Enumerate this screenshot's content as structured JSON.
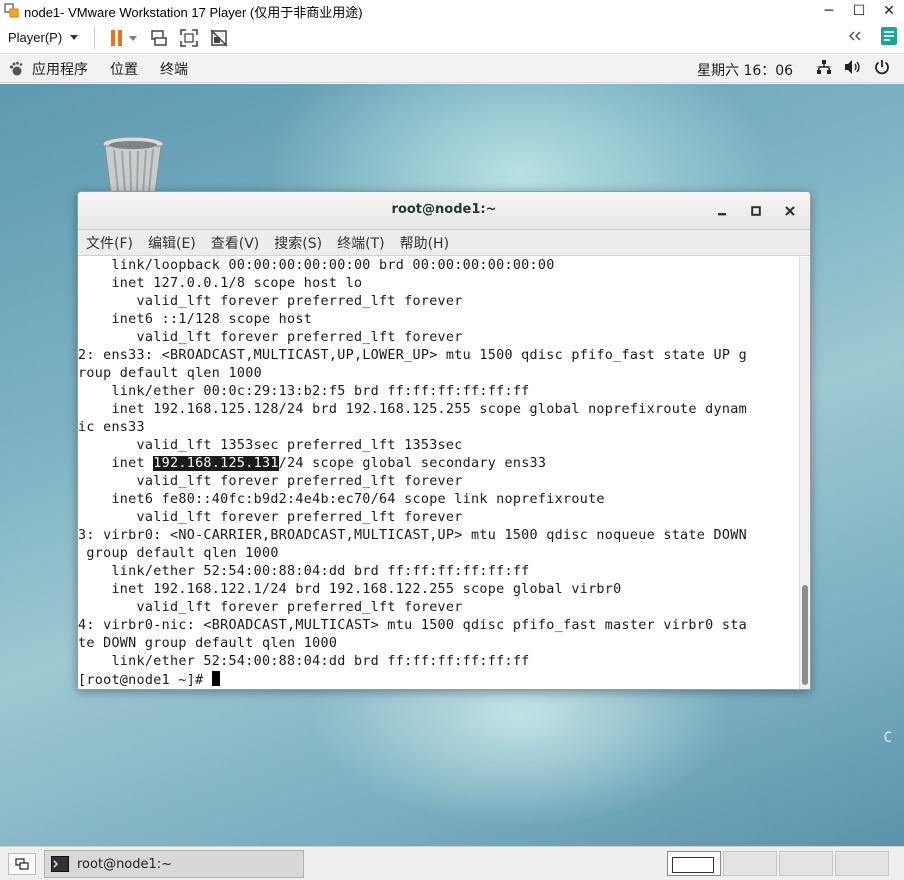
{
  "vmware": {
    "title": "node1- VMware Workstation 17 Player (仅用于非商业用途)",
    "player_menu": "Player(P)",
    "colors": {
      "accent": "#e8731b",
      "pause": "#e8731b"
    }
  },
  "gnome": {
    "apps": "应用程序",
    "places": "位置",
    "terminal": "终端",
    "clock": "星期六 16：06"
  },
  "terminal": {
    "title": "root@node1:~",
    "menu": [
      "文件(F)",
      "编辑(E)",
      "查看(V)",
      "搜索(S)",
      "终端(T)",
      "帮助(H)"
    ],
    "lines": [
      "    link/loopback 00:00:00:00:00:00 brd 00:00:00:00:00:00",
      "    inet 127.0.0.1/8 scope host lo",
      "       valid_lft forever preferred_lft forever",
      "    inet6 ::1/128 scope host",
      "       valid_lft forever preferred_lft forever",
      "2: ens33: <BROADCAST,MULTICAST,UP,LOWER_UP> mtu 1500 qdisc pfifo_fast state UP g",
      "roup default qlen 1000",
      "    link/ether 00:0c:29:13:b2:f5 brd ff:ff:ff:ff:ff:ff",
      "    inet 192.168.125.128/24 brd 192.168.125.255 scope global noprefixroute dynam",
      "ic ens33",
      "       valid_lft 1353sec preferred_lft 1353sec"
    ],
    "hl_prefix": "    inet ",
    "hl_ip": "192.168.125.131",
    "hl_suffix": "/24 scope global secondary ens33",
    "lines2": [
      "       valid_lft forever preferred_lft forever",
      "    inet6 fe80::40fc:b9d2:4e4b:ec70/64 scope link noprefixroute",
      "       valid_lft forever preferred_lft forever",
      "3: virbr0: <NO-CARRIER,BROADCAST,MULTICAST,UP> mtu 1500 qdisc noqueue state DOWN",
      " group default qlen 1000",
      "    link/ether 52:54:00:88:04:dd brd ff:ff:ff:ff:ff:ff",
      "    inet 192.168.122.1/24 brd 192.168.122.255 scope global virbr0",
      "       valid_lft forever preferred_lft forever",
      "4: virbr0-nic: <BROADCAST,MULTICAST> mtu 1500 qdisc pfifo_fast master virbr0 sta",
      "te DOWN group default qlen 1000",
      "    link/ether 52:54:00:88:04:dd brd ff:ff:ff:ff:ff:ff"
    ],
    "prompt": "[root@node1 ~]# "
  },
  "desktop": {
    "edge_char": "C"
  },
  "taskbar": {
    "task_label": "root@node1:~"
  }
}
